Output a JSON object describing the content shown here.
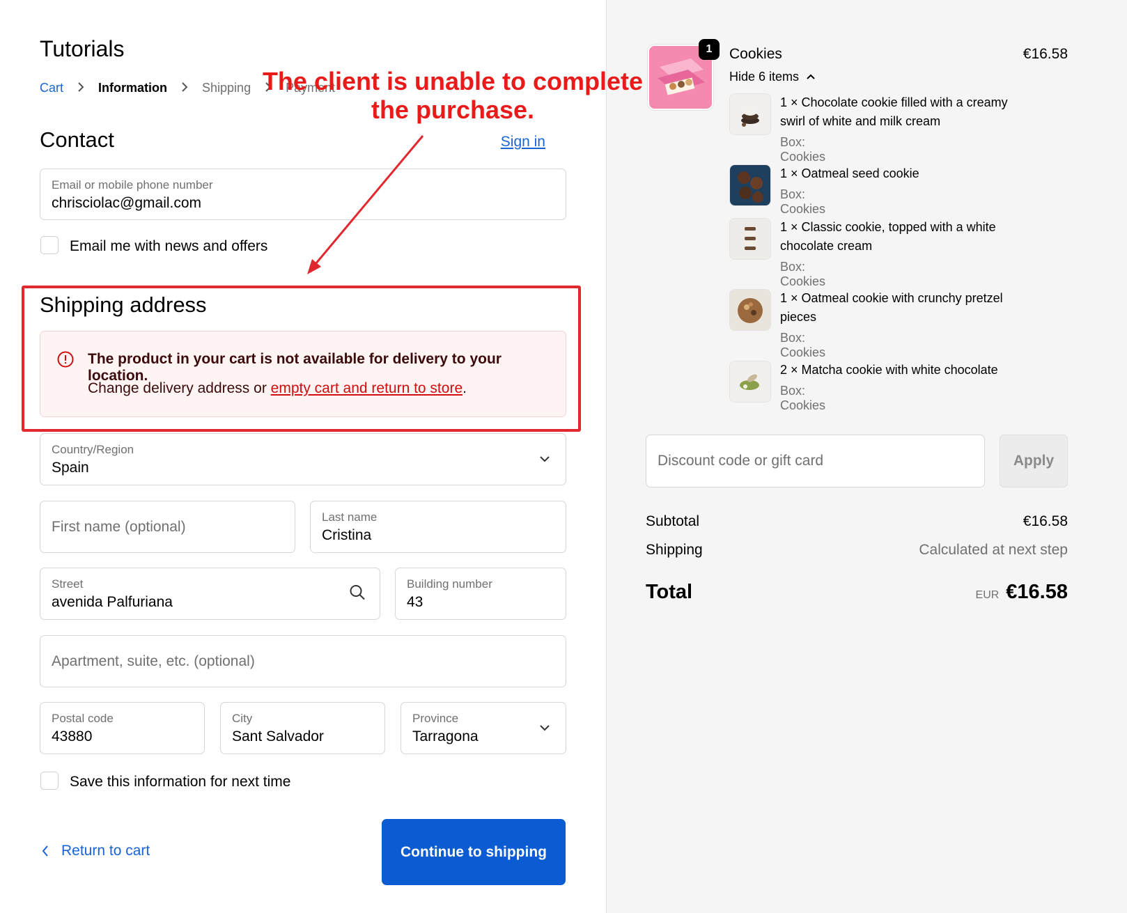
{
  "store": {
    "title": "Tutorials"
  },
  "breadcrumb": {
    "cart": "Cart",
    "information": "Information",
    "shipping": "Shipping",
    "payment": "Payment"
  },
  "contact": {
    "heading": "Contact",
    "sign_in": "Sign in",
    "email_label": "Email or mobile phone number",
    "email_value": "chrisciolac@gmail.com",
    "news_label": "Email me with news and offers"
  },
  "shipping": {
    "heading": "Shipping address",
    "alert_title": "The product in your cart is not available for delivery to your location.",
    "alert_text": "Change delivery address or ",
    "alert_link": "empty cart and return to store",
    "alert_end": ".",
    "country_label": "Country/Region",
    "country_value": "Spain",
    "first_name_placeholder": "First name (optional)",
    "last_name_label": "Last name",
    "last_name_value": "Cristina",
    "street_label": "Street",
    "street_value": "avenida Palfuriana",
    "building_label": "Building number",
    "building_value": "43",
    "apartment_placeholder": "Apartment, suite, etc. (optional)",
    "postal_label": "Postal code",
    "postal_value": "43880",
    "city_label": "City",
    "city_value": "Sant Salvador",
    "province_label": "Province",
    "province_value": "Tarragona",
    "save_label": "Save this information for next time"
  },
  "actions": {
    "return": "Return to cart",
    "continue": "Continue to shipping"
  },
  "annotation": {
    "line1": "The client is unable to complete",
    "line2": "the purchase."
  },
  "summary": {
    "product_name": "Cookies",
    "product_price": "€16.58",
    "badge": "1",
    "hide_items": "Hide 6 items",
    "items": [
      {
        "name": "1 × Chocolate cookie filled with a creamy swirl of white and milk cream",
        "box": "Box: Cookies"
      },
      {
        "name": "1 × Oatmeal seed cookie",
        "box": "Box: Cookies"
      },
      {
        "name": "1 × Classic cookie, topped with a white chocolate cream",
        "box": "Box: Cookies"
      },
      {
        "name": "1 × Oatmeal cookie with crunchy pretzel pieces",
        "box": "Box: Cookies"
      },
      {
        "name": "2 × Matcha cookie with white chocolate",
        "box": "Box: Cookies"
      }
    ],
    "discount_placeholder": "Discount code or gift card",
    "apply": "Apply",
    "subtotal_label": "Subtotal",
    "subtotal_value": "€16.58",
    "shipping_label": "Shipping",
    "shipping_value": "Calculated at next step",
    "total_label": "Total",
    "total_currency": "EUR",
    "total_value": "€16.58"
  },
  "colors": {
    "accent": "#0b5bd3",
    "link": "#1964d5",
    "error": "#d10d0d",
    "annotation": "#e81a1a"
  }
}
